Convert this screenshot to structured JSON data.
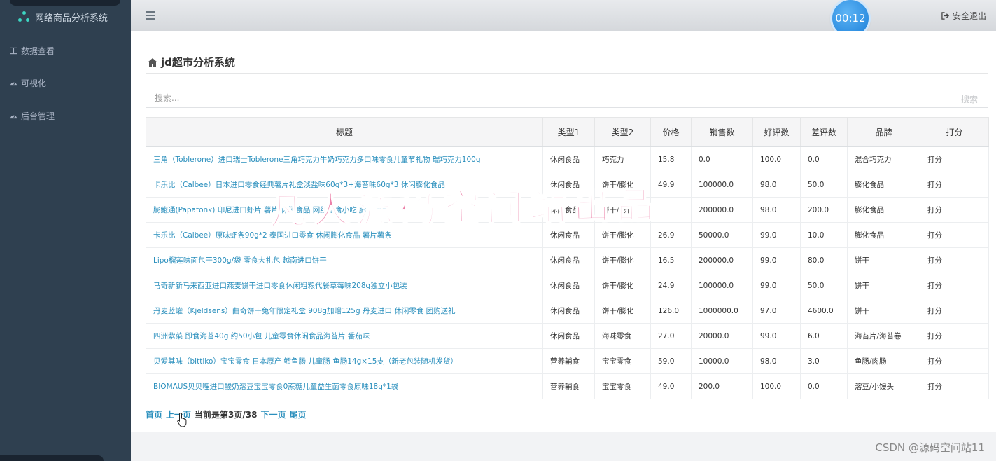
{
  "sidebar": {
    "brand": "网络商品分析系统",
    "items": [
      {
        "label": "数据查看"
      },
      {
        "label": "可视化"
      },
      {
        "label": "后台管理"
      }
    ]
  },
  "topbar": {
    "timer": "00:12",
    "logout": "安全退出"
  },
  "page": {
    "title": "jd超市分析系统"
  },
  "search": {
    "placeholder": "搜索...",
    "button": "搜索"
  },
  "table": {
    "headers": [
      "标题",
      "类型1",
      "类型2",
      "价格",
      "销售数",
      "好评数",
      "差评数",
      "品牌",
      "打分"
    ],
    "rows": [
      [
        "三角（Toblerone）进口瑞士Toblerone三角巧克力牛奶巧克力多口味零食儿童节礼物 瑞巧克力100g",
        "休闲食品",
        "巧克力",
        "15.8",
        "0.0",
        "100.0",
        "0.0",
        "混合巧克力",
        "打分"
      ],
      [
        "卡乐比（Calbee）日本进口零食经典薯片礼盒淡盐味60g*3+海苔味60g*3 休闲膨化食品",
        "休闲食品",
        "饼干/膨化",
        "49.9",
        "100000.0",
        "98.0",
        "50.0",
        "膨化食品",
        "打分"
      ],
      [
        "膨鲍通(Papatonk) 印尼进口虾片 薯片 休闲食品 网红零食小吃 膨化食品",
        "休闲食品",
        "饼干/膨化",
        "",
        "200000.0",
        "98.0",
        "200.0",
        "膨化食品",
        "打分"
      ],
      [
        "卡乐比（Calbee）原味虾条90g*2 泰国进口零食 休闲膨化食品 薯片薯条",
        "休闲食品",
        "饼干/膨化",
        "26.9",
        "50000.0",
        "99.0",
        "10.0",
        "膨化食品",
        "打分"
      ],
      [
        "Lipo榴莲味面包干300g/袋 零食大礼包 越南进口饼干",
        "休闲食品",
        "饼干/膨化",
        "16.5",
        "200000.0",
        "99.0",
        "80.0",
        "饼干",
        "打分"
      ],
      [
        "马奇新新马来西亚进口燕麦饼干进口零食休闲粗粮代餐草莓味208g独立小包装",
        "休闲食品",
        "饼干/膨化",
        "24.9",
        "100000.0",
        "99.0",
        "50.0",
        "饼干",
        "打分"
      ],
      [
        "丹麦蓝罐（Kjeldsens）曲奇饼干兔年限定礼盒 908g加赠125g 丹麦进口 休闲零食 团购送礼",
        "休闲食品",
        "饼干/膨化",
        "126.0",
        "1000000.0",
        "97.0",
        "4600.0",
        "饼干",
        "打分"
      ],
      [
        "四洲紫菜 即食海苔40g 约50小包 儿童零食休闲食品海苔片 番茄味",
        "休闲食品",
        "海味零食",
        "27.0",
        "20000.0",
        "99.0",
        "6.0",
        "海苔片/海苔卷",
        "打分"
      ],
      [
        "贝爱其味（bittiko）宝宝零食 日本原产 鳕鱼肠 儿童肠 鱼肠14g×15支（新老包装随机发货）",
        "营养辅食",
        "宝宝零食",
        "59.0",
        "10000.0",
        "98.0",
        "3.0",
        "鱼肠/肉肠",
        "打分"
      ],
      [
        "BIOMAUS贝贝哩进口酸奶溶豆宝宝零食0蔗糖儿童益生菌零食原味18g*1袋",
        "营养辅食",
        "宝宝零食",
        "49.0",
        "200.0",
        "100.0",
        "0.0",
        "溶豆/小馒头",
        "打分"
      ]
    ]
  },
  "pager": {
    "first": "首页",
    "prev": "上一页",
    "status": "当前是第3页/38",
    "next": "下一页",
    "last": "尾页"
  },
  "overlay": {
    "watermark": "凡人源码空间站出品",
    "credit": "CSDN @源码空间站11"
  }
}
